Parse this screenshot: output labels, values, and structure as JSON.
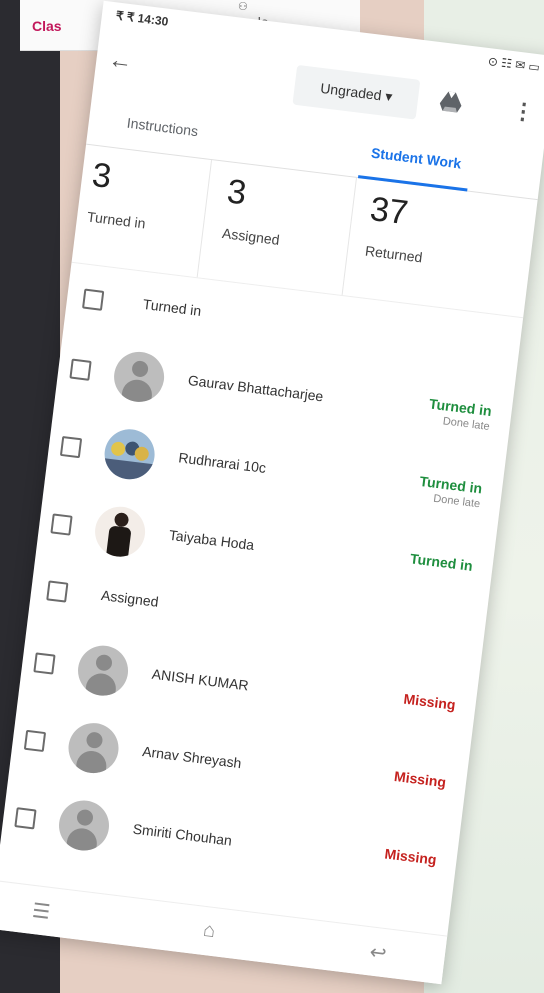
{
  "background": {
    "tab_classwork_partial": "Clas",
    "tab_people": "People"
  },
  "status_bar": {
    "time": "14:30",
    "left_extra": "₹ ₹",
    "right_icons": "⊙ ☷ ✉ ▭"
  },
  "toolbar": {
    "grade_filter": "Ungraded ▾"
  },
  "tabs": {
    "instructions": "Instructions",
    "student_work": "Student Work"
  },
  "stats": [
    {
      "num": "3",
      "label": "Turned in"
    },
    {
      "num": "3",
      "label": "Assigned"
    },
    {
      "num": "37",
      "label": "Returned"
    }
  ],
  "sections": {
    "turned_in": "Turned in",
    "assigned": "Assigned"
  },
  "turned_in_students": [
    {
      "name": "Gaurav Bhattacharjee",
      "status": "Turned in",
      "sub": "Done late"
    },
    {
      "name": "Rudhrarai 10c",
      "status": "Turned in",
      "sub": "Done late"
    },
    {
      "name": "Taiyaba Hoda",
      "status": "Turned in",
      "sub": ""
    }
  ],
  "assigned_students": [
    {
      "name": "ANISH KUMAR",
      "status": "Missing"
    },
    {
      "name": "Arnav Shreyash",
      "status": "Missing"
    },
    {
      "name": "Smiriti Chouhan",
      "status": "Missing"
    }
  ],
  "colors": {
    "accent": "#1a73e8",
    "turned_in": "#1e8e3e",
    "missing": "#c5221f"
  }
}
